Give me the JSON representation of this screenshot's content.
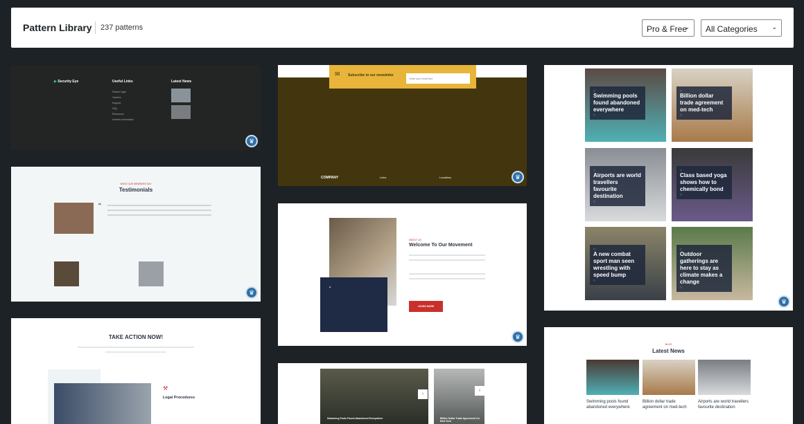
{
  "header": {
    "title": "Pattern Library",
    "count": "237 patterns",
    "filter_plan": "Pro & Free",
    "filter_category": "All Categories",
    "chevron": "chevron-down-icon"
  },
  "colors": {
    "background": "#1d2226",
    "badge": "#2e6fa8",
    "accent_red": "#c9302c",
    "navy": "#1f2a44"
  },
  "patterns": {
    "footer_dark": {
      "brand": "Security Eye",
      "col2": "Useful Links",
      "col3": "Latest News",
      "links": [
        "Partner login",
        "Careers",
        "Support",
        "FAQ",
        "Resources",
        "Investor information"
      ]
    },
    "testimonials": {
      "eyebrow": "WHAT OUR MEMBERS SAY",
      "title": "Testimonials"
    },
    "take_action": {
      "title": "TAKE ACTION NOW!",
      "feature": "Legal Procedures"
    },
    "newsletter": {
      "title": "Subscribe to our newsletter",
      "placeholder": "Enter your email here",
      "company": "COMPANY",
      "links": "Links",
      "locations": "Locations"
    },
    "movement": {
      "eyebrow": "ABOUT US",
      "title": "Welcome To Our Movement",
      "button": "LEARN MORE"
    },
    "slider": {
      "slides": [
        "Swimming Pools Found Abandoned Everywhere",
        "Billion Dollar Trade Agreement On Med-Tech"
      ]
    },
    "news_grid": {
      "items": [
        "Swimming pools found abandoned everywhere",
        "Billion dollar trade agreement on med-tech",
        "Airports are world travellers favourite destination",
        "Class based yoga shows how to chemically bond",
        "A new combat sport man seen wrestling with speed bump",
        "Outdoor gatherings are here to stay as climate makes a change"
      ]
    },
    "latest_news": {
      "eyebrow": "BLOG",
      "title": "Latest News",
      "items": [
        "Swimming pools found abandoned everywhere",
        "Billion dollar trade agreement on med-tech",
        "Airports are world travellers favourite destination"
      ]
    }
  }
}
